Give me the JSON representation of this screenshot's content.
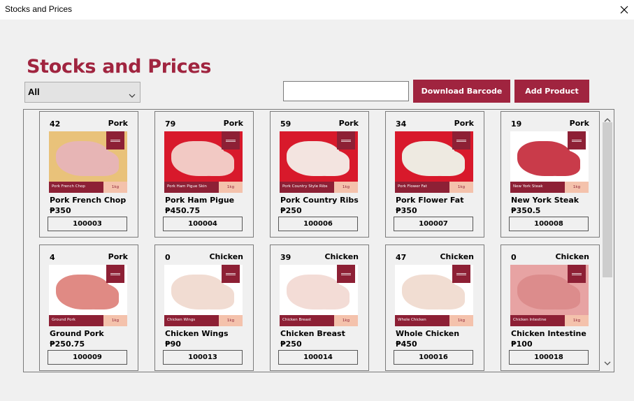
{
  "window": {
    "title": "Stocks and Prices"
  },
  "page": {
    "heading": "Stocks and Prices"
  },
  "filter": {
    "selected": "All"
  },
  "search": {
    "value": "",
    "placeholder": ""
  },
  "toolbar": {
    "download_label": "Download Barcode",
    "add_label": "Add Product"
  },
  "products": [
    {
      "qty": "42",
      "category": "Pork",
      "name": "Pork French Chop",
      "price": "₱350",
      "code": "100003",
      "label": "Pork French Chop",
      "weight": "1kg",
      "bg": "#e9c27a",
      "meat": "#e7b5b5"
    },
    {
      "qty": "79",
      "category": "Pork",
      "name": "Pork Ham Pigue",
      "price": "₱450.75",
      "code": "100004",
      "label": "Pork Ham Pigue Skin",
      "weight": "1kg",
      "bg": "#d8192b",
      "meat": "#f2c9c4"
    },
    {
      "qty": "59",
      "category": "Pork",
      "name": "Pork Country Ribs",
      "price": "₱250",
      "code": "100006",
      "label": "Pork Country Style Ribs",
      "weight": "1kg",
      "bg": "#d8192b",
      "meat": "#f3e4e0"
    },
    {
      "qty": "34",
      "category": "Pork",
      "name": "Pork Flower Fat",
      "price": "₱350",
      "code": "100007",
      "label": "Pork Flower Fat",
      "weight": "1kg",
      "bg": "#d8192b",
      "meat": "#eeeae1"
    },
    {
      "qty": "19",
      "category": "Pork",
      "name": "New York Steak",
      "price": "₱350.5",
      "code": "100008",
      "label": "New York Steak",
      "weight": "1kg",
      "bg": "#ffffff",
      "meat": "#c93b4a"
    },
    {
      "qty": "4",
      "category": "Pork",
      "name": "Ground Pork",
      "price": "₱250.75",
      "code": "100009",
      "label": "Ground Pork",
      "weight": "1kg",
      "bg": "#ffffff",
      "meat": "#e08a84"
    },
    {
      "qty": "0",
      "category": "Chicken",
      "name": "Chicken Wings",
      "price": "₱90",
      "code": "100013",
      "label": "Chicken Wings",
      "weight": "1kg",
      "bg": "#ffffff",
      "meat": "#f1dcd2"
    },
    {
      "qty": "39",
      "category": "Chicken",
      "name": "Chicken Breast",
      "price": "₱250",
      "code": "100014",
      "label": "Chicken Breast",
      "weight": "1kg",
      "bg": "#ffffff",
      "meat": "#f3dcd6"
    },
    {
      "qty": "47",
      "category": "Chicken",
      "name": "Whole Chicken",
      "price": "₱450",
      "code": "100016",
      "label": "Whole Chicken",
      "weight": "1kg",
      "bg": "#ffffff",
      "meat": "#f1ddd2"
    },
    {
      "qty": "0",
      "category": "Chicken",
      "name": "Chicken Intestine",
      "price": "₱100",
      "code": "100018",
      "label": "Chicken Intestine",
      "weight": "1kg",
      "bg": "#e7a3a3",
      "meat": "#dc8c8c"
    }
  ]
}
